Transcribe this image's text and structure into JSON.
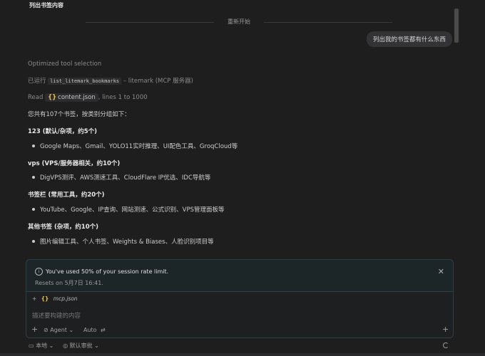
{
  "title": "列出书签内容",
  "divider_label": "重新开始",
  "user_message": "列出我的书签都有什么东西",
  "tool_line": "Optimized tool selection",
  "ran_prefix": "已运行",
  "ran_tool": "list_litemark_bookmarks",
  "ran_suffix": "– litemark (MCP 服务器)",
  "read_prefix": "Read",
  "read_file": "content.json",
  "read_suffix": ", lines 1 to 1000",
  "summary": "您共有107个书签，按类别分组如下：",
  "sections": [
    {
      "heading": "123 (默认/杂项，约5个)",
      "bullet": "Google Maps、Gmail、YOLO11实时推理、UI配色工具、GroqCloud等"
    },
    {
      "heading": "vps (VPS/服务器相关，约10个)",
      "bullet": "DigVPS测评、AWS测速工具、CloudFlare IP优选、IDC导航等"
    },
    {
      "heading": "书签栏 (常用工具，约20个)",
      "bullet": "YouTube、Google、IP查询、网站测速、公式识别、VPS管理面板等"
    },
    {
      "heading": "其他书签 (杂项，约10个)",
      "bullet": "图片编辑工具、个人书签、Weights & Biases、人脸识别项目等"
    }
  ],
  "rate_limit": {
    "message": "You've used 50% of your session rate limit.",
    "reset": "Resets on 5月7日 16:41."
  },
  "composer": {
    "context_file": "mcp.json",
    "placeholder": "描述要构建的内容",
    "agent_label": "Agent",
    "auto_label": "Auto"
  },
  "bottom": {
    "local_label": "本地",
    "approve_label": "默认审批"
  },
  "colors": {
    "background": "#1e1e1f",
    "rate_box_border": "#2d4046",
    "json_icon": "#e6c04a"
  }
}
